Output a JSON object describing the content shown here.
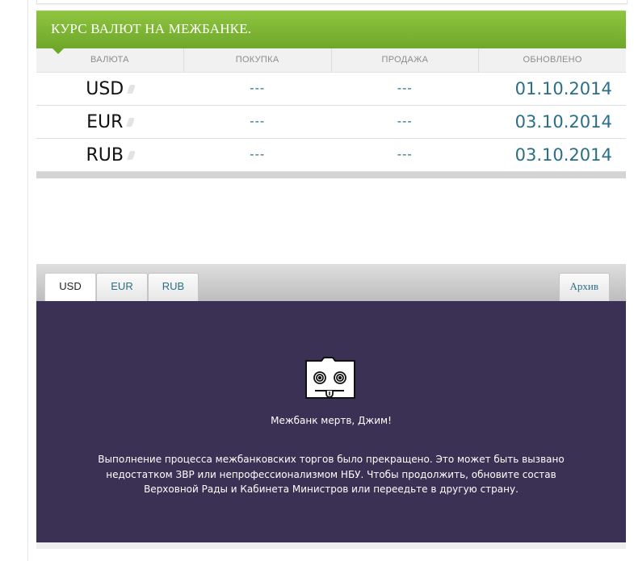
{
  "rates": {
    "title": "КУРС ВАЛЮТ НА МЕЖБАНКЕ.",
    "columns": [
      "ВАЛЮТА",
      "ПОКУПКА",
      "ПРОДАЖА",
      "ОБНОВЛЕНО"
    ],
    "rows": [
      {
        "currency": "USD",
        "buy": "---",
        "sell": "---",
        "updated": "01.10.2014"
      },
      {
        "currency": "EUR",
        "buy": "---",
        "sell": "---",
        "updated": "03.10.2014"
      },
      {
        "currency": "RUB",
        "buy": "---",
        "sell": "---",
        "updated": "03.10.2014"
      }
    ]
  },
  "chart_panel": {
    "tabs": [
      {
        "label": "USD",
        "active": true
      },
      {
        "label": "EUR",
        "active": false
      },
      {
        "label": "RUB",
        "active": false
      }
    ],
    "archive_label": "Архив",
    "dead_title": "Межбанк мертв, Джим!",
    "dead_message": "Выполнение процесса межбанковских торгов было прекращено. Это может быть вызвано недостатком ЗВР или непрофессионализмом НБУ. Чтобы продолжить, обновите состав Верховной Рады и Кабинета Министров или переедьте в другую страну.",
    "icon": "sad-tab-icon"
  },
  "colors": {
    "header_green": "#7cb535",
    "link_teal": "#2a6f86",
    "dead_background": "#3a3154"
  }
}
